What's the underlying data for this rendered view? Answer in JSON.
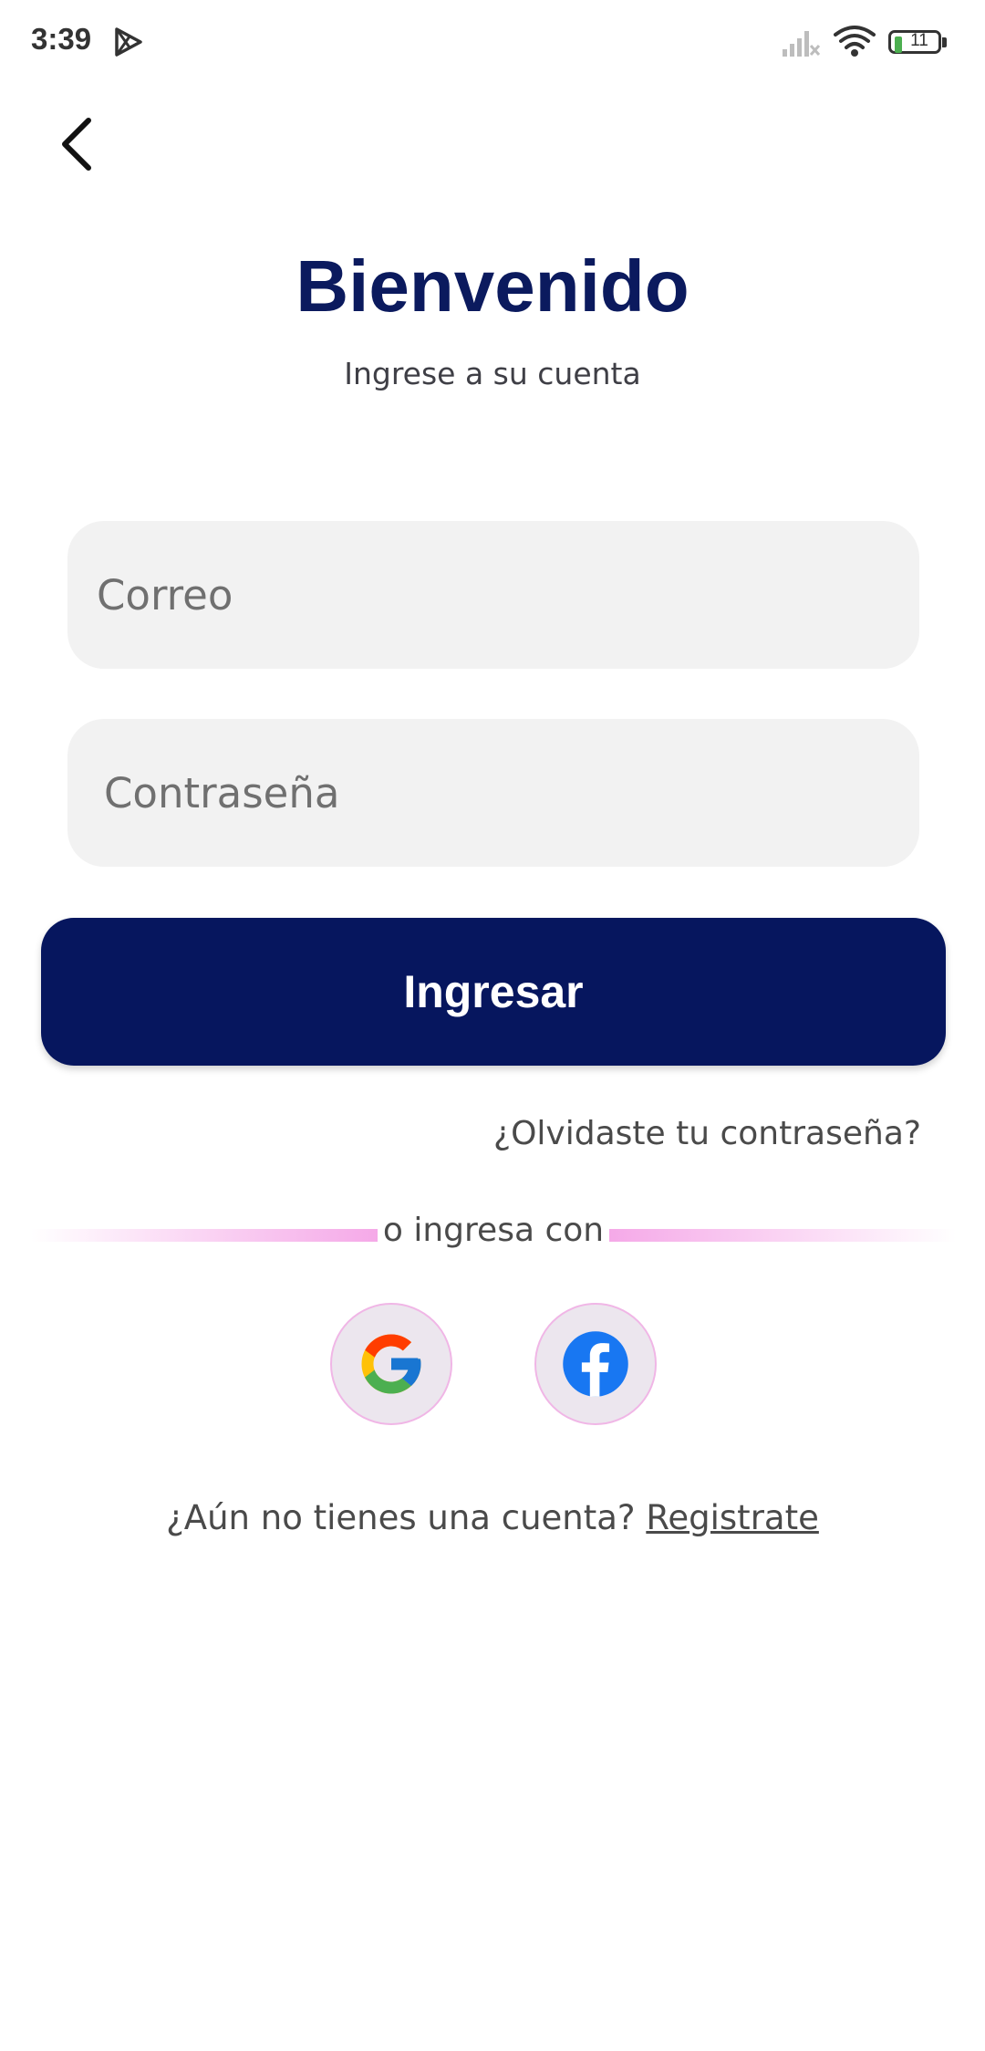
{
  "status_bar": {
    "time": "3:39",
    "battery_level": "11",
    "icons": [
      "play-store-icon",
      "signal-icon",
      "wifi-icon",
      "battery-icon"
    ]
  },
  "header": {
    "back_icon": "chevron-left-icon"
  },
  "main": {
    "title": "Bienvenido",
    "subtitle": "Ingrese a su cuenta",
    "email": {
      "placeholder": "Correo",
      "value": ""
    },
    "password": {
      "placeholder": "Contraseña",
      "value": ""
    },
    "login_label": "Ingresar",
    "forgot_label": "¿Olvidaste tu contraseña?",
    "divider_label": "o ingresa con",
    "social": [
      {
        "name": "google",
        "icon": "google-icon"
      },
      {
        "name": "facebook",
        "icon": "facebook-icon"
      }
    ],
    "register_prompt": "¿Aún no tienes una cuenta? ",
    "register_link": "Registrate"
  },
  "colors": {
    "primary": "#06165e",
    "title": "#0b1a5e",
    "field_bg": "#f2f2f2",
    "accent_pink": "#f5a9e8",
    "facebook_blue": "#1877f2"
  }
}
